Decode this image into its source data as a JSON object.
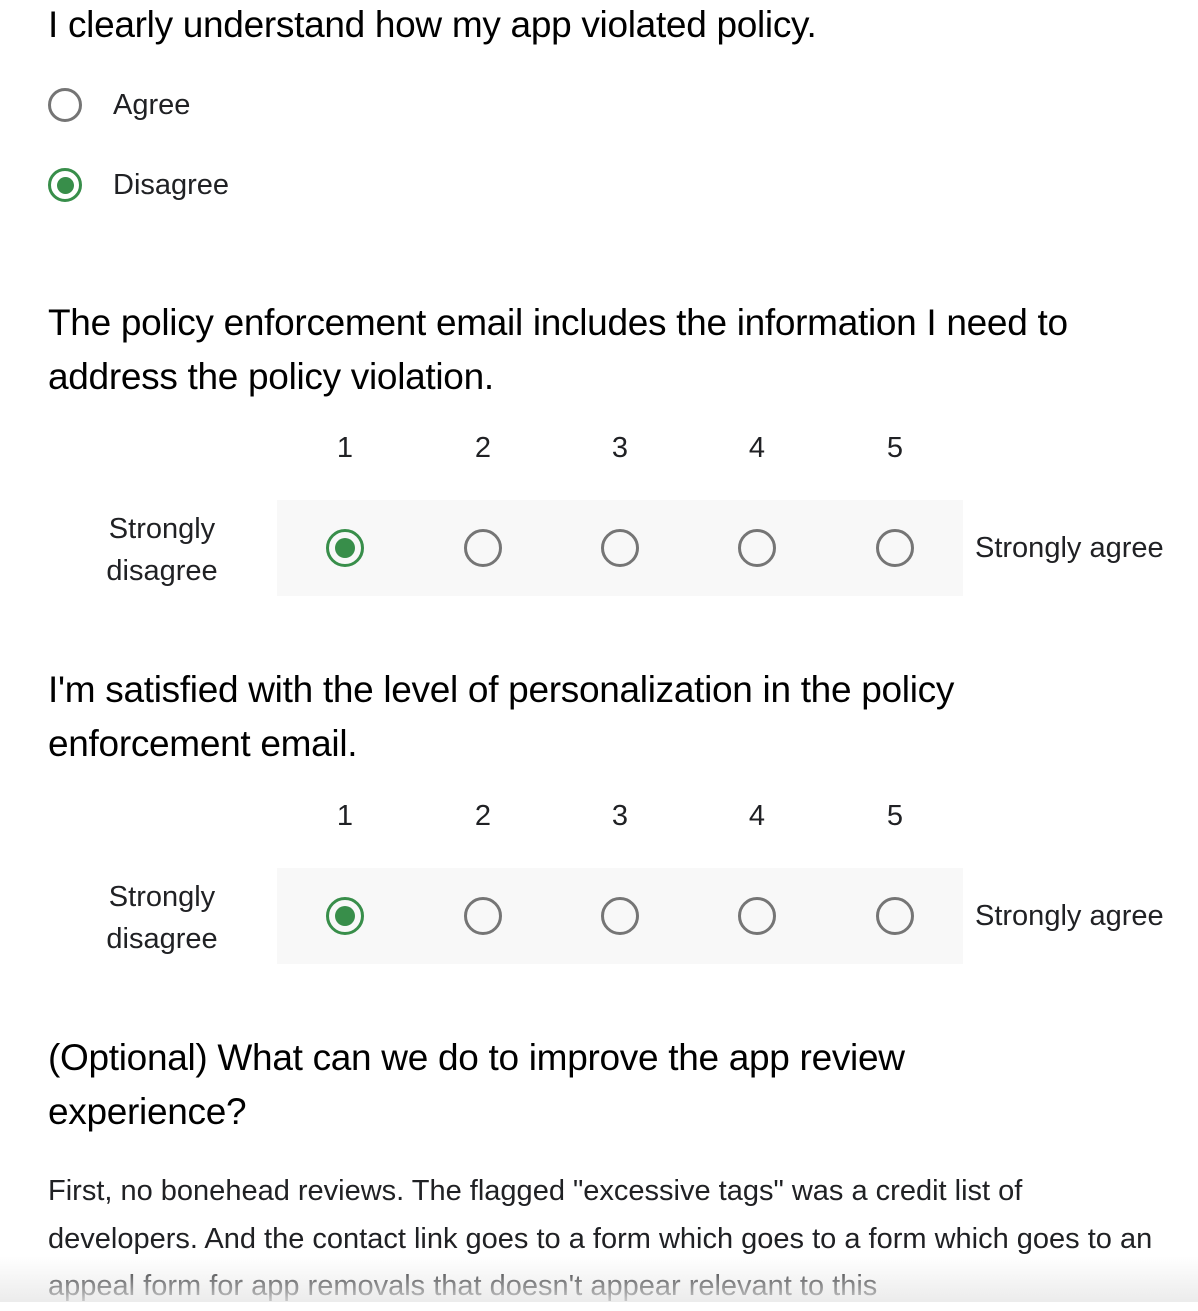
{
  "q1": {
    "title": "I clearly understand how my app violated policy.",
    "options": [
      {
        "label": "Agree",
        "checked": false
      },
      {
        "label": "Disagree",
        "checked": true
      }
    ]
  },
  "q2": {
    "title": "The policy enforcement email includes the information I need to address the policy violation.",
    "scale": [
      "1",
      "2",
      "3",
      "4",
      "5"
    ],
    "low_label": "Strongly disagree",
    "high_label": "Strongly agree",
    "selected": 1
  },
  "q3": {
    "title": "I'm satisfied with the level of personalization in the policy enforcement email.",
    "scale": [
      "1",
      "2",
      "3",
      "4",
      "5"
    ],
    "low_label": "Strongly disagree",
    "high_label": "Strongly agree",
    "selected": 1
  },
  "q4": {
    "title": "(Optional) What can we do to improve the app review experience?",
    "answer": "First, no bonehead reviews. The flagged \"excessive tags\" was a credit list of developers. And the contact link goes to a form which goes to a form which goes to an appeal form for app removals that doesn't appear relevant to this"
  },
  "colors": {
    "accent": "#388e4a",
    "radio_unchecked": "#757575",
    "scale_background": "#f8f8f8"
  }
}
